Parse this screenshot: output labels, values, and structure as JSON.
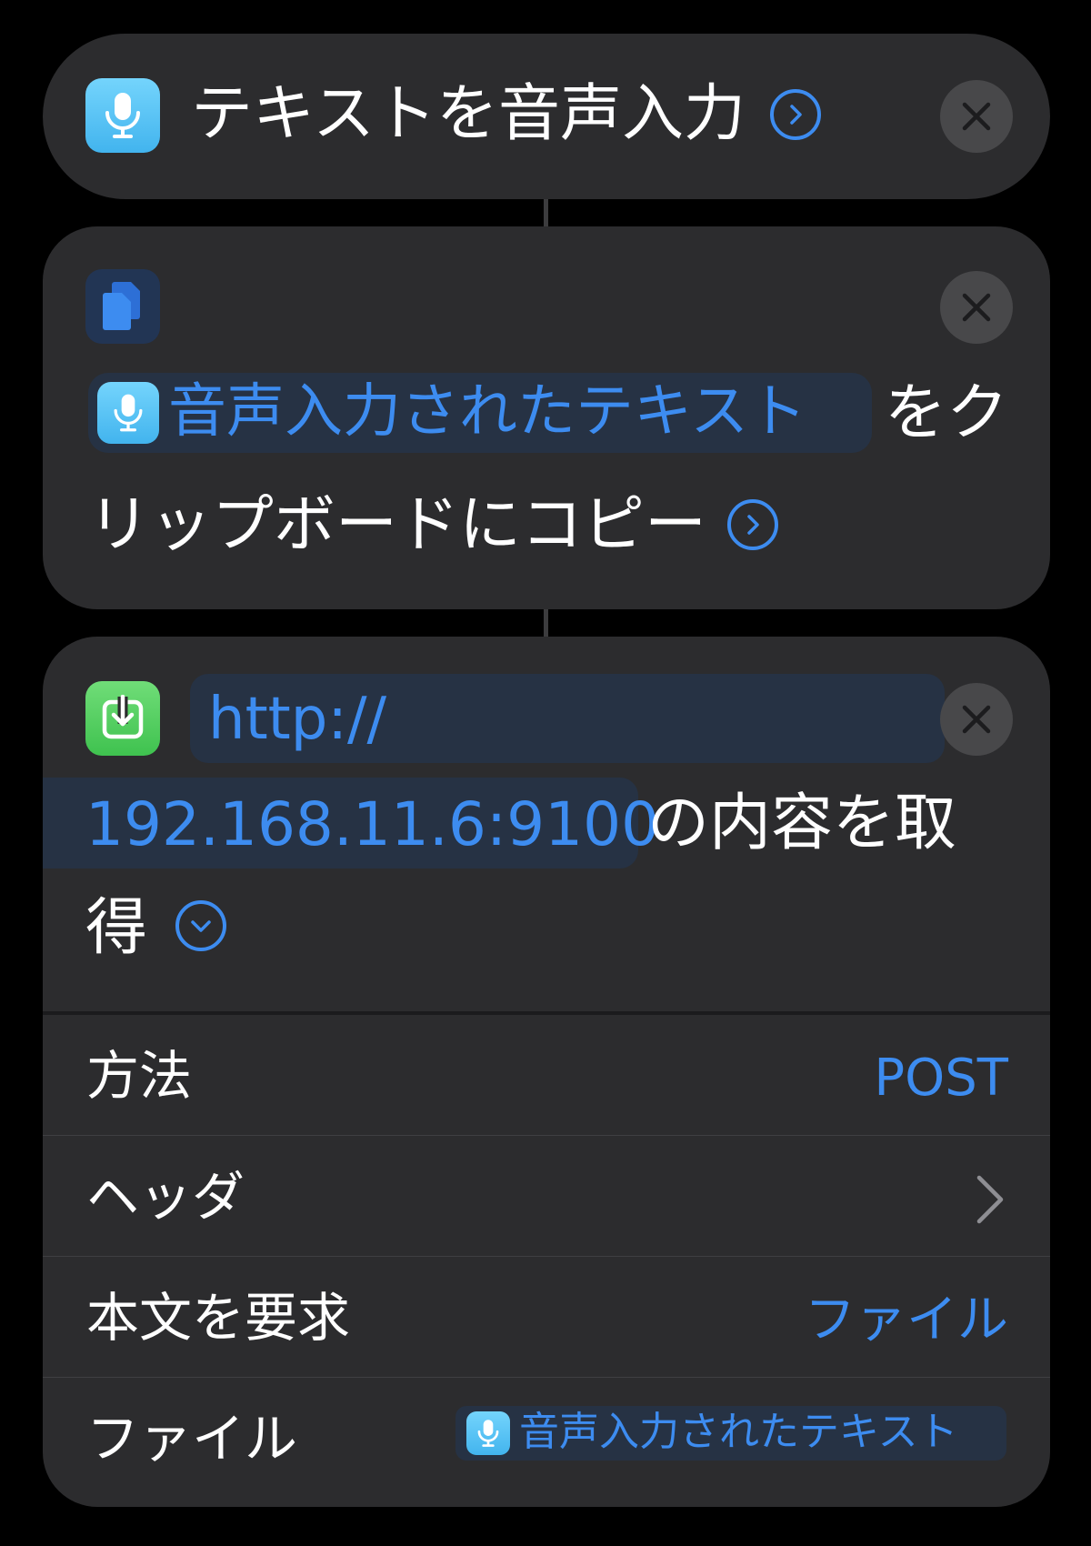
{
  "actions": {
    "dictate": {
      "title": "テキストを音声入力"
    },
    "copy": {
      "variable_label": "音声入力されたテキスト",
      "text_part1": "をク",
      "text_part2": "リップボードにコピー"
    },
    "fetch": {
      "url_line1": "http://",
      "url_line2": "192.168.11.6:9100",
      "text_part1": "の内容を取",
      "text_part2": "得",
      "params": {
        "method": {
          "label": "方法",
          "value": "POST"
        },
        "headers": {
          "label": "ヘッダ"
        },
        "body": {
          "label": "本文を要求",
          "value": "ファイル"
        },
        "file": {
          "label": "ファイル",
          "variable_label": "音声入力されたテキスト"
        }
      }
    }
  },
  "icons": {
    "dictate": "microphone-icon",
    "copy": "clipboard-icon",
    "fetch": "download-icon",
    "close": "close-icon",
    "expand": "chevron-right-circle-icon",
    "collapse": "chevron-down-circle-icon",
    "disclosure": "chevron-right-icon"
  },
  "colors": {
    "background": "#000000",
    "card": "#2c2c2e",
    "accent": "#3d8cf0",
    "mic_icon": "#5ac8fa",
    "download_icon": "#4cd05c",
    "clipboard_icon": "#3478f6"
  }
}
